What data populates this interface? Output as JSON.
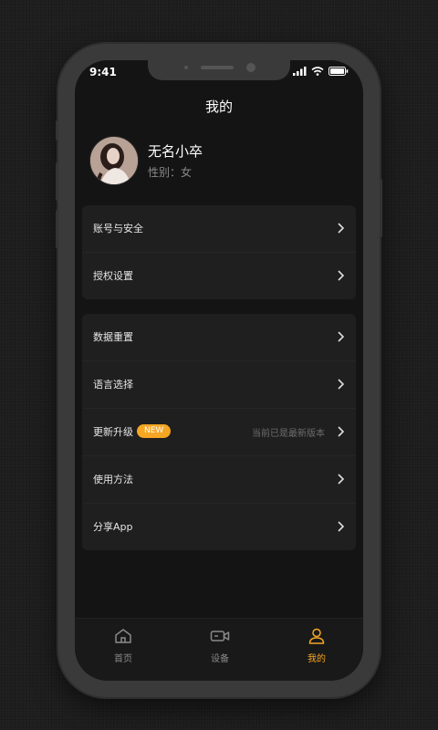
{
  "status_bar": {
    "time": "9:41"
  },
  "header": {
    "title": "我的"
  },
  "profile": {
    "nickname": "无名小卒",
    "gender": "性别：女"
  },
  "group1": [
    {
      "label": "账号与安全"
    },
    {
      "label": "授权设置"
    }
  ],
  "group2": [
    {
      "label": "数据重置"
    },
    {
      "label": "语言选择"
    },
    {
      "label": "更新升级",
      "badge": "NEW",
      "hint": "当前已是最新版本"
    },
    {
      "label": "使用方法"
    },
    {
      "label": "分享App"
    }
  ],
  "tabs": [
    {
      "label": "首页",
      "icon": "home-icon",
      "active": false
    },
    {
      "label": "设备",
      "icon": "camera-icon",
      "active": false
    },
    {
      "label": "我的",
      "icon": "user-icon",
      "active": true
    }
  ],
  "colors": {
    "accent": "#f5a623",
    "inactive": "#8a8a8a",
    "background": "#141414",
    "card": "#1f1f1f"
  }
}
